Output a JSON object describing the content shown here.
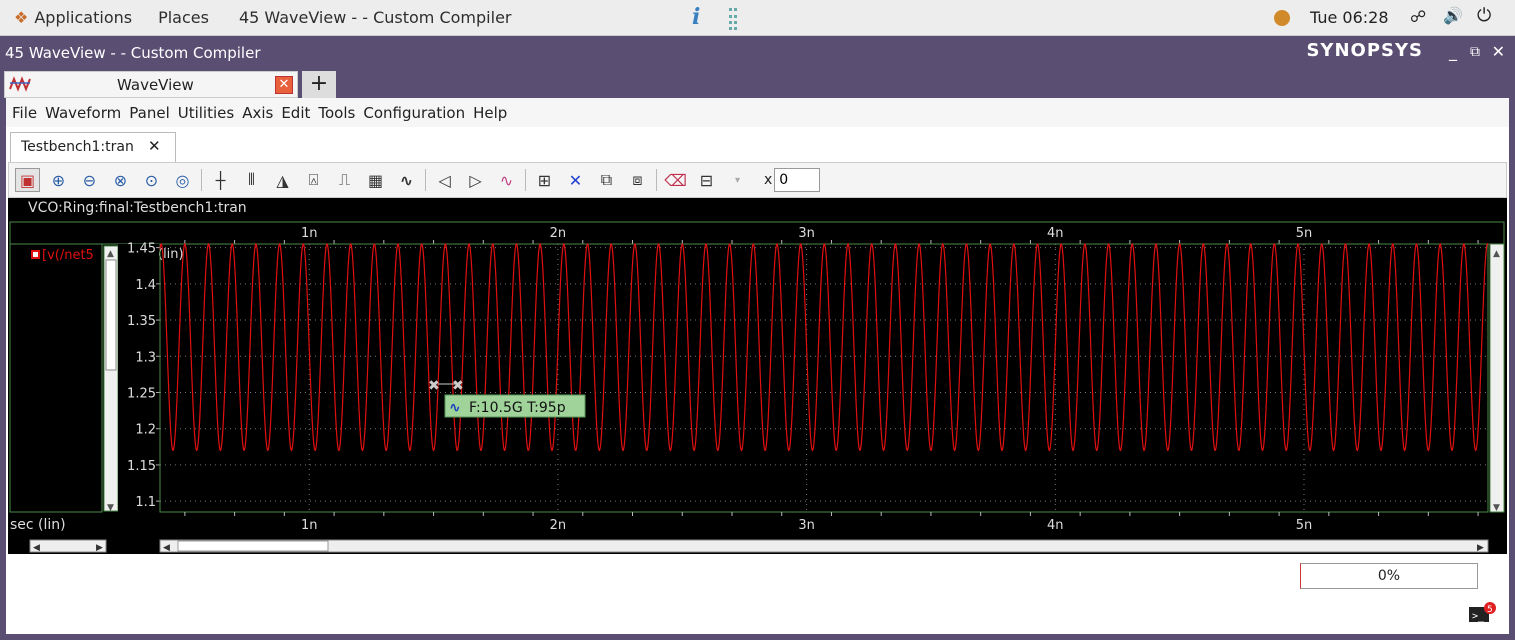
{
  "topbar": {
    "applications": "Applications",
    "places": "Places",
    "window_title": "45 WaveView -  - Custom Compiler",
    "clock": "Tue 06:28"
  },
  "window": {
    "title": "45 WaveView -  - Custom Compiler",
    "brand": "SYNOPSYS",
    "tab_label": "WaveView"
  },
  "menu": [
    "File",
    "Waveform",
    "Panel",
    "Utilities",
    "Axis",
    "Edit",
    "Tools",
    "Configuration",
    "Help"
  ],
  "doc_tab": {
    "label": "Testbench1:tran",
    "close": "✕"
  },
  "toolbar": {
    "x_label": "x",
    "x_value": "0"
  },
  "panel": {
    "title": "VCO:Ring:final:Testbench1:tran",
    "signal_name": "[v(/net5",
    "y_scale_label": "(lin)",
    "x_axis_label": "sec (lin)",
    "y_ticks": [
      "1.45",
      "1.4",
      "1.35",
      "1.3",
      "1.25",
      "1.2",
      "1.15",
      "1.1"
    ],
    "x_ticks": [
      "1n",
      "2n",
      "3n",
      "4n",
      "5n"
    ],
    "marker_label": "F:10.5G T:95p",
    "signal_color": "#e01010"
  },
  "chart_data": {
    "type": "line",
    "series": [
      {
        "name": "[v(/net5",
        "frequency_hz": 10500000000.0,
        "min": 1.17,
        "max": 1.455
      }
    ],
    "xlabel": "sec (lin)",
    "ylabel": "(lin)",
    "xlim": [
      4e-10,
      5.74e-09
    ],
    "ylim": [
      1.085,
      1.455
    ],
    "grid": true
  },
  "status": {
    "progress": "0%",
    "notification_count": "5"
  }
}
